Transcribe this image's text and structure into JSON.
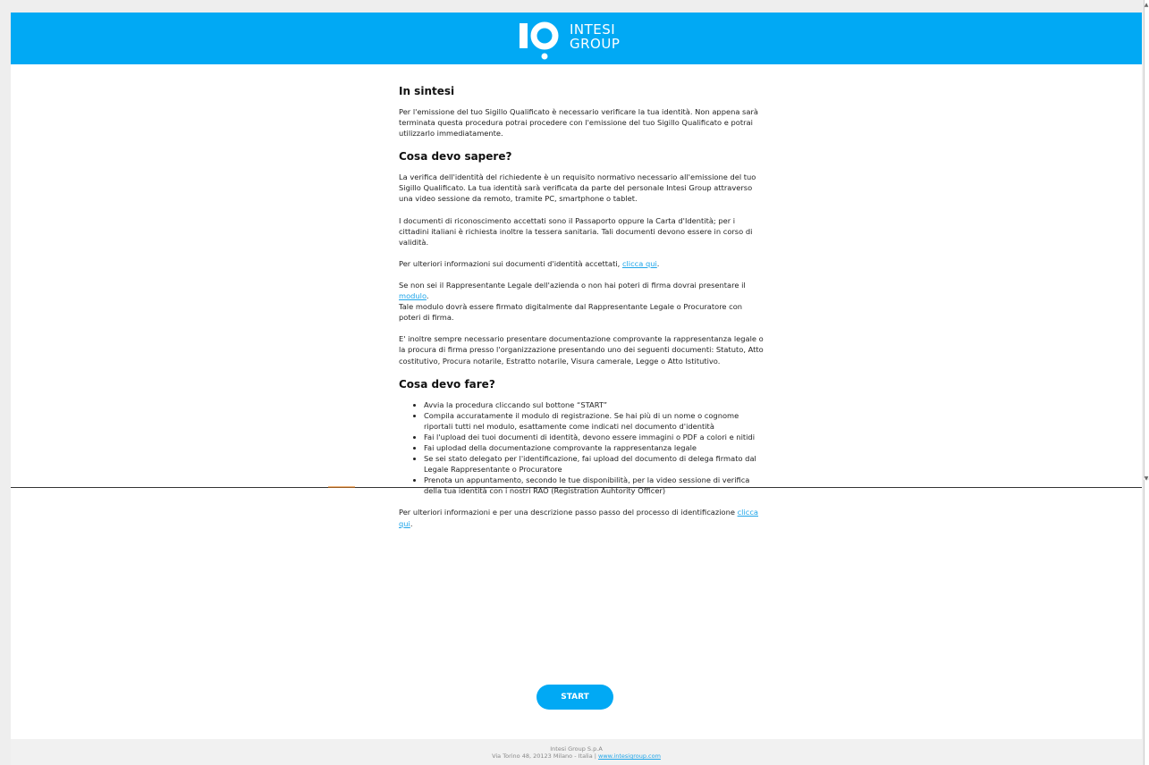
{
  "header": {
    "brand_line1": "INTESI",
    "brand_line2": "GROUP"
  },
  "sections": {
    "sintesi": {
      "title": "In sintesi",
      "text": "Per l'emissione del tuo Sigillo Qualificato è necessario verificare la tua identità. Non appena sarà terminata questa procedura potrai procedere con l'emissione del tuo Sigillo Qualificato e potrai utilizzarlo immediatamente."
    },
    "sapere": {
      "title": "Cosa devo sapere?",
      "p1": "La verifica dell'identità del richiedente è un requisito normativo necessario all'emissione del tuo Sigillo Qualificato. La tua identità sarà verificata da parte del personale Intesi Group attraverso una video sessione da remoto, tramite PC, smartphone o tablet.",
      "p2": "I documenti di riconoscimento accettati sono il Passaporto oppure la Carta d'Identità; per i cittadini italiani è richiesta inoltre la tessera sanitaria. Tali documenti devono essere in corso di validità.",
      "p3_prefix": "Per ulteriori informazioni sui documenti d'identità accettati, ",
      "p3_link": "clicca qui",
      "p3_suffix": ".",
      "p4_prefix": "Se non sei il Rappresentante Legale dell'azienda o non hai poteri di firma dovrai presentare il ",
      "p4_link": "modulo",
      "p4_suffix": ".",
      "p4_line2": "Tale modulo dovrà essere firmato digitalmente dal Rappresentante Legale o Procuratore con poteri di firma.",
      "p5": "E' inoltre sempre necessario presentare documentazione comprovante la rappresentanza legale o la procura di firma presso l'organizzazione presentando uno dei seguenti documenti: Statuto, Atto costitutivo, Procura notarile, Estratto notarile, Visura camerale, Legge o Atto Istitutivo."
    },
    "fare": {
      "title": "Cosa devo fare?",
      "steps": [
        "Avvia la procedura cliccando sul bottone “START”",
        "Compila accuratamente il modulo di registrazione. Se hai più di un nome o cognome riportali tutti nel modulo, esattamente come indicati nel documento d'identità",
        "Fai l'upload dei tuoi documenti di identità, devono essere immagini o PDF a colori e nitidi",
        "Fai uplodad della documentazione comprovante la rappresentanza legale",
        "Se sei stato delegato per l'identificazione, fai upload del documento di delega firmato dal Legale Rappresentante o Procuratore",
        "Prenota un appuntamento, secondo le tue disponibilità, per la video sessione di verifica della tua identità con i nostri RAO (Registration Auhtority Officer)"
      ],
      "closing_prefix": "Per ulteriori informazioni e per una descrizione passo passo del processo di identificazione ",
      "closing_link": "clicca qui",
      "closing_suffix": "."
    }
  },
  "start_button": "START",
  "footer": {
    "company": "Intesi Group S.p.A",
    "address": "Via Torino 48, 20123 Milano - Italia | ",
    "website": "www.intesigroup.com"
  },
  "colors": {
    "primary": "#01a9f4",
    "link": "#1ea5e9",
    "footer_bg": "#f1f1f1"
  }
}
